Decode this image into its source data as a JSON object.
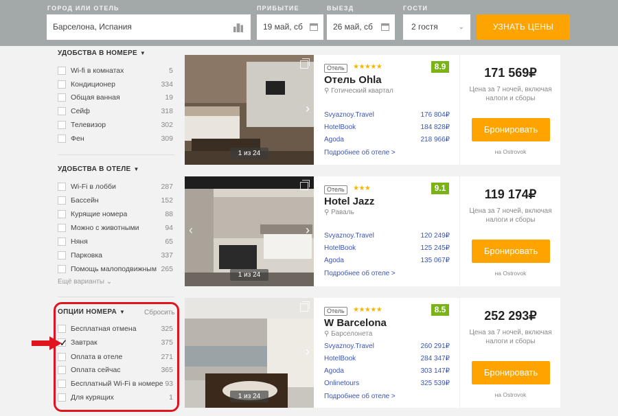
{
  "search": {
    "city_label": "ГОРОД ИЛИ ОТЕЛЬ",
    "city_value": "Барселона, Испания",
    "checkin_label": "ПРИБЫТИЕ",
    "checkin_value": "19 май, сб",
    "checkout_label": "ВЫЕЗД",
    "checkout_value": "26 май, сб",
    "guests_label": "ГОСТИ",
    "guests_value": "2 гостя",
    "submit_label": "УЗНАТЬ ЦЕНЫ"
  },
  "filters": {
    "room_amenities": {
      "title": "УДОБСТВА В НОМЕРЕ",
      "items": [
        {
          "label": "Wi-fi в комнатах",
          "count": "5"
        },
        {
          "label": "Кондиционер",
          "count": "334"
        },
        {
          "label": "Общая ванная",
          "count": "19"
        },
        {
          "label": "Сейф",
          "count": "318"
        },
        {
          "label": "Телевизор",
          "count": "302"
        },
        {
          "label": "Фен",
          "count": "309"
        }
      ]
    },
    "hotel_amenities": {
      "title": "УДОБСТВА В ОТЕЛЕ",
      "items": [
        {
          "label": "Wi-Fi в лобби",
          "count": "287"
        },
        {
          "label": "Бассейн",
          "count": "152"
        },
        {
          "label": "Курящие номера",
          "count": "88"
        },
        {
          "label": "Можно с животными",
          "count": "94"
        },
        {
          "label": "Няня",
          "count": "65"
        },
        {
          "label": "Парковка",
          "count": "337"
        },
        {
          "label": "Помощь малоподвижным",
          "count": "265"
        }
      ],
      "more_label": "Ещё варианты"
    },
    "room_options": {
      "title": "ОПЦИИ НОМЕРА",
      "reset_label": "Сбросить",
      "items": [
        {
          "label": "Бесплатная отмена",
          "count": "325",
          "checked": false
        },
        {
          "label": "Завтрак",
          "count": "375",
          "checked": true
        },
        {
          "label": "Оплата в отеле",
          "count": "271",
          "checked": false
        },
        {
          "label": "Оплата сейчас",
          "count": "365",
          "checked": false
        },
        {
          "label": "Бесплатный Wi-Fi в номере",
          "count": "93",
          "checked": false
        },
        {
          "label": "Для курящих",
          "count": "1",
          "checked": false
        }
      ]
    }
  },
  "hotels": [
    {
      "type": "Отель",
      "stars": "★★★★★",
      "score": "8.9",
      "name": "Отель Ohla",
      "location": "Готический квартал",
      "photo_counter": "1 из 24",
      "offers": [
        {
          "source": "Svyaznoy.Travel",
          "price": "176 804₽"
        },
        {
          "source": "HotelBook",
          "price": "184 828₽"
        },
        {
          "source": "Agoda",
          "price": "218 966₽"
        }
      ],
      "more_link": "Подробнее об отеле >",
      "price": "171 569₽",
      "price_note": "Цена за 7 ночей, включая налоги и сборы",
      "book_label": "Бронировать",
      "via": "на Ostrovok"
    },
    {
      "type": "Отель",
      "stars": "★★★",
      "score": "9.1",
      "name": "Hotel Jazz",
      "location": "Раваль",
      "photo_counter": "1 из 24",
      "offers": [
        {
          "source": "Svyaznoy.Travel",
          "price": "120 249₽"
        },
        {
          "source": "HotelBook",
          "price": "125 245₽"
        },
        {
          "source": "Agoda",
          "price": "135 067₽"
        }
      ],
      "more_link": "Подробнее об отеле >",
      "price": "119 174₽",
      "price_note": "Цена за 7 ночей, включая налоги и сборы",
      "book_label": "Бронировать",
      "via": "на Ostrovok"
    },
    {
      "type": "Отель",
      "stars": "★★★★★",
      "score": "8.5",
      "name": "W Barcelona",
      "location": "Барселонета",
      "photo_counter": "1 из 24",
      "offers": [
        {
          "source": "Svyaznoy.Travel",
          "price": "260 291₽"
        },
        {
          "source": "HotelBook",
          "price": "284 347₽"
        },
        {
          "source": "Agoda",
          "price": "303 147₽"
        },
        {
          "source": "Onlinetours",
          "price": "325 539₽"
        }
      ],
      "more_link": "Подробнее об отеле >",
      "price": "252 293₽",
      "price_note": "Цена за 7 ночей, включая налоги и сборы",
      "book_label": "Бронировать",
      "via": "на Ostrovok"
    }
  ],
  "colors": {
    "accent": "#fea401",
    "score": "#7ab317",
    "link": "#3a55b5",
    "annotation": "#e0141e",
    "search_bar": "#a3a9a9"
  }
}
